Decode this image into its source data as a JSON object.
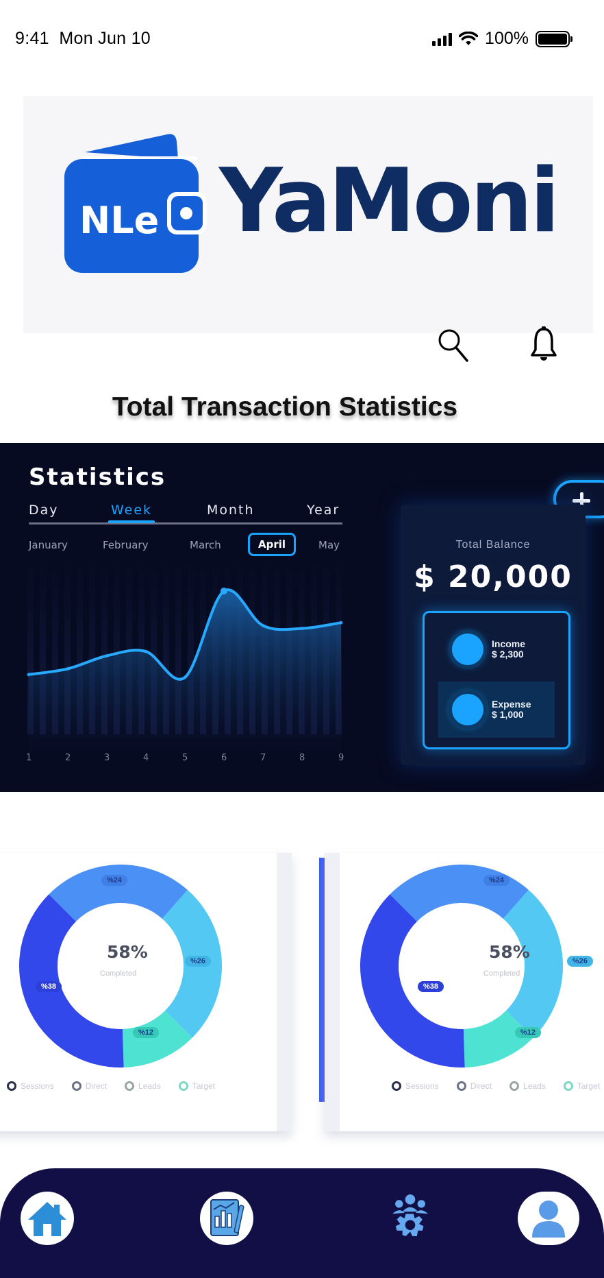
{
  "status_bar": {
    "time": "9:41",
    "date": "Mon Jun 10",
    "battery_text": "100%",
    "icons": [
      "cellular-signal-icon",
      "wifi-icon",
      "battery-icon"
    ]
  },
  "header": {
    "logo_wordmark": "YaMoni",
    "logo_badge_text": "NLe",
    "icons": [
      "search-icon",
      "bell-icon"
    ]
  },
  "section_title": "Total Transaction Statistics",
  "stats": {
    "title": "Statistics",
    "periods": [
      "Day",
      "Week",
      "Month",
      "Year"
    ],
    "active_period": "Week",
    "months": [
      "January",
      "February",
      "March",
      "April",
      "May"
    ],
    "active_month": "April",
    "add_button_icon": "plus-icon",
    "balance_label": "Total Balance",
    "balance_value": "$ 20,000",
    "income_label": "Income",
    "income_value": "$ 2,300",
    "expense_label": "Expense",
    "expense_value": "$ 1,000",
    "colors": {
      "background": "#070b22",
      "accent": "#1aa4ff"
    }
  },
  "chart_data": {
    "type": "area",
    "x": [
      1,
      2,
      3,
      4,
      5,
      6,
      7,
      8,
      9
    ],
    "values": [
      3.2,
      3.6,
      4.5,
      4.8,
      3.0,
      9.0,
      6.6,
      6.4,
      6.8
    ],
    "xlabel": "",
    "ylabel": "",
    "grid": false
  },
  "donut_cards": [
    {
      "center_value": "58%",
      "center_label": "Completed",
      "segments": [
        {
          "label": "%24",
          "value": 24,
          "color": "#4a90f5"
        },
        {
          "label": "%26",
          "value": 26,
          "color": "#52c8f2"
        },
        {
          "label": "%12",
          "value": 12,
          "color": "#4de2d2"
        },
        {
          "label": "%38",
          "value": 38,
          "color": "#3348ea"
        }
      ],
      "legend": [
        "Sessions",
        "Direct",
        "Leads",
        "Target"
      ]
    },
    {
      "center_value": "58%",
      "center_label": "Completed",
      "segments": [
        {
          "label": "%24",
          "value": 24,
          "color": "#4a90f5"
        },
        {
          "label": "%26",
          "value": 26,
          "color": "#52c8f2"
        },
        {
          "label": "%12",
          "value": 12,
          "color": "#4de2d2"
        },
        {
          "label": "%38",
          "value": 38,
          "color": "#3348ea"
        }
      ],
      "legend": [
        "Sessions",
        "Direct",
        "Leads",
        "Target"
      ]
    }
  ],
  "bottom_nav": {
    "items": [
      "home-icon",
      "report-icon",
      "team-settings-icon",
      "profile-icon"
    ],
    "color": "#120e46"
  }
}
